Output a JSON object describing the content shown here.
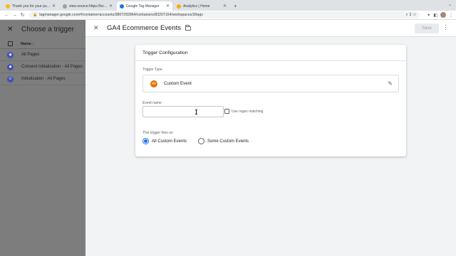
{
  "browser": {
    "tabs": [
      {
        "title": "Thank you for your purchase!",
        "favicon_color": "#fbbc04",
        "active": false
      },
      {
        "title": "view-source:https://bovex-dui...",
        "favicon_color": "#5f6368",
        "active": false
      },
      {
        "title": "Google Tag Manager",
        "favicon_color": "#1a73e8",
        "active": true
      },
      {
        "title": "Analytics | Home",
        "favicon_color": "#f9ab00",
        "active": false
      }
    ],
    "new_tab": "+",
    "url": "tagmanager.google.com/#/container/accounts/3807292864/containers/83207164/workspaces/3/tags"
  },
  "left_panel": {
    "title": "Choose a trigger",
    "column_name": "Name ↑",
    "rows": [
      {
        "label": "All Pages",
        "icon_color": "#3f51b5",
        "icon": "eye-icon"
      },
      {
        "label": "Consent Initialization - All Pages",
        "icon_color": "#3f51b5",
        "icon": "shield-icon"
      },
      {
        "label": "Initialization - All Pages",
        "icon_color": "#3f51b5",
        "icon": "power-icon"
      }
    ]
  },
  "drawer": {
    "title": "GA4 Ecommerce Events",
    "save_label": "Save"
  },
  "card": {
    "title": "Trigger Configuration",
    "trigger_type_label": "Trigger Type",
    "trigger_type_value": "Custom Event",
    "event_name_label": "Event name",
    "event_name_value": "",
    "regex_label": "Use regex matching",
    "fires_on_label": "This trigger fires on",
    "options": [
      {
        "label": "All Custom Events",
        "selected": true
      },
      {
        "label": "Some Custom Events",
        "selected": false
      }
    ]
  },
  "colors": {
    "accent": "#1a73e8",
    "custom_event_icon": "#e8710a"
  }
}
